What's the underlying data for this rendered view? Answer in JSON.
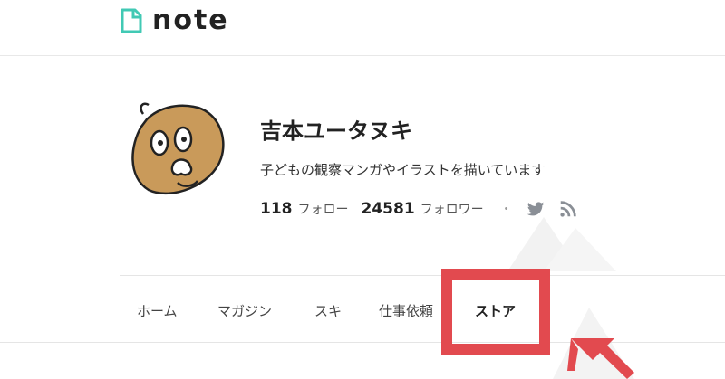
{
  "header": {
    "logo_text": "note",
    "logo_icon": "note-logo-icon"
  },
  "profile": {
    "name": "吉本ユータヌキ",
    "bio": "子どもの観察マンガやイラストを描いています",
    "follow_count": "118",
    "follow_label": "フォロー",
    "follower_count": "24581",
    "follower_label": "フォロワー",
    "separator": "・",
    "avatar_icon": "tanuki-avatar",
    "social_icons": [
      "twitter-icon",
      "rss-icon"
    ]
  },
  "tabs": {
    "home": "ホーム",
    "magazine": "マガジン",
    "likes": "スキ",
    "request": "仕事依頼",
    "store": "ストア"
  },
  "colors": {
    "highlight": "#e24a4f",
    "logo_accent": "#41c9b4"
  }
}
